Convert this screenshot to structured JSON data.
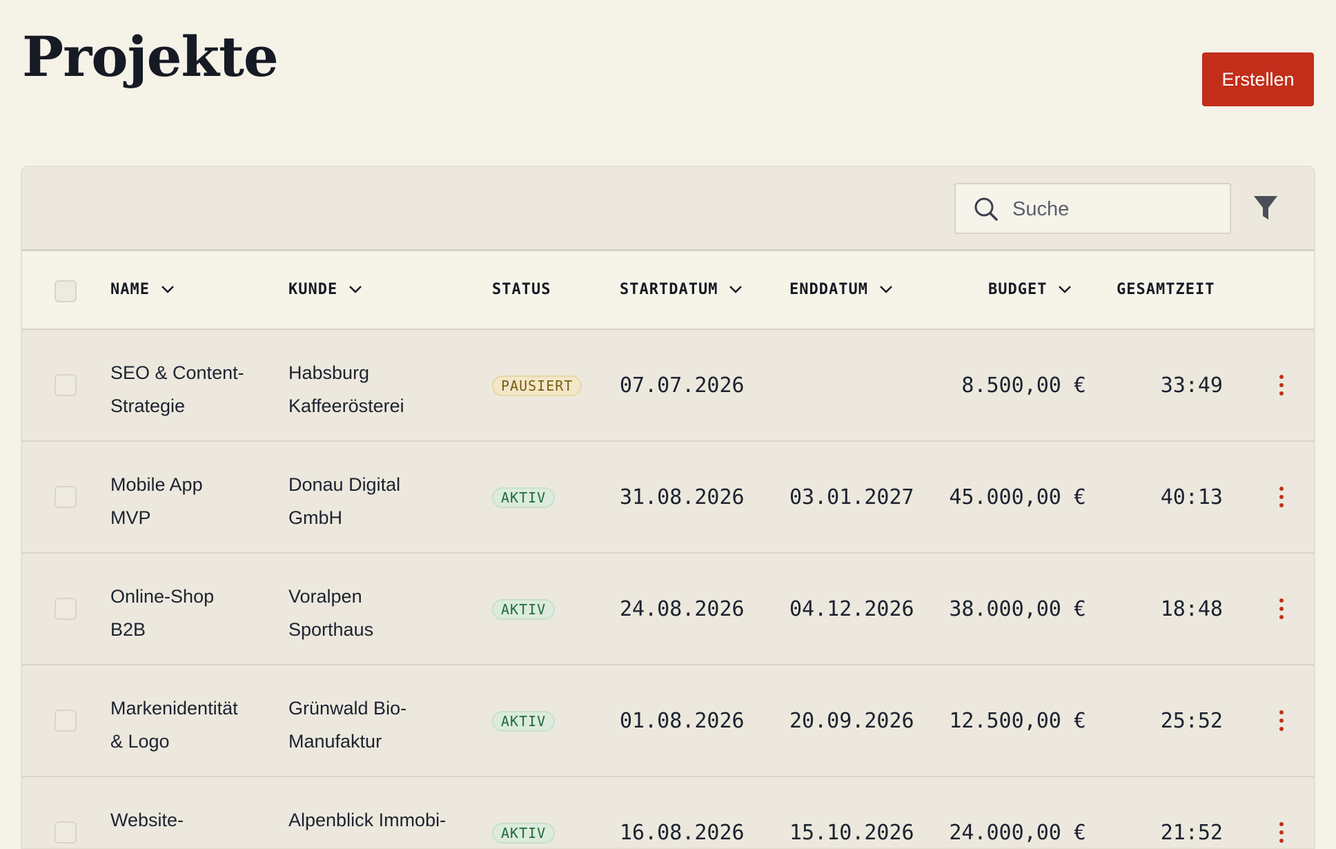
{
  "page": {
    "title": "Projekte",
    "create_label": "Erstellen"
  },
  "toolbar": {
    "search_placeholder": "Suche",
    "search_value": ""
  },
  "colors": {
    "accent": "#c22e1a",
    "background": "#f5f2e7",
    "panel": "#ece8dd",
    "status_paused": "#7a5a10",
    "status_active": "#1f6b37"
  },
  "icons": {
    "search": "search-icon",
    "filter": "filter-icon",
    "sort": "chevron-down-icon",
    "row_menu": "kebab-menu-icon"
  },
  "table": {
    "columns": {
      "name": "NAME",
      "kunde": "KUNDE",
      "status": "STATUS",
      "startdatum": "STARTDATUM",
      "enddatum": "ENDDATUM",
      "budget": "BUDGET",
      "gesamtzeit": "GESAMTZEIT"
    },
    "rows": [
      {
        "name_line1": "SEO & Content-",
        "name_line2": "Strategie",
        "kunde_line1": "Habsburg",
        "kunde_line2": "Kaffeerösterei",
        "status": "PAUSIERT",
        "status_kind": "paused",
        "start": "07.07.2026",
        "end": "",
        "budget": "8.500,00 €",
        "time": "33:49"
      },
      {
        "name_line1": "Mobile App",
        "name_line2": "MVP",
        "kunde_line1": "Donau Digital",
        "kunde_line2": "GmbH",
        "status": "AKTIV",
        "status_kind": "active",
        "start": "31.08.2026",
        "end": "03.01.2027",
        "budget": "45.000,00 €",
        "time": "40:13"
      },
      {
        "name_line1": "Online-Shop",
        "name_line2": "B2B",
        "kunde_line1": "Voralpen",
        "kunde_line2": "Sporthaus",
        "status": "AKTIV",
        "status_kind": "active",
        "start": "24.08.2026",
        "end": "04.12.2026",
        "budget": "38.000,00 €",
        "time": "18:48"
      },
      {
        "name_line1": "Markenidentität",
        "name_line2": "& Logo",
        "kunde_line1": "Grünwald Bio-",
        "kunde_line2": "Manufaktur",
        "status": "AKTIV",
        "status_kind": "active",
        "start": "01.08.2026",
        "end": "20.09.2026",
        "budget": "12.500,00 €",
        "time": "25:52"
      },
      {
        "name_line1": "Website-",
        "name_line2": "",
        "kunde_line1": "Alpenblick Immobi-",
        "kunde_line2": "",
        "status": "AKTIV",
        "status_kind": "active",
        "start": "16.08.2026",
        "end": "15.10.2026",
        "budget": "24.000,00 €",
        "time": "21:52"
      }
    ]
  }
}
